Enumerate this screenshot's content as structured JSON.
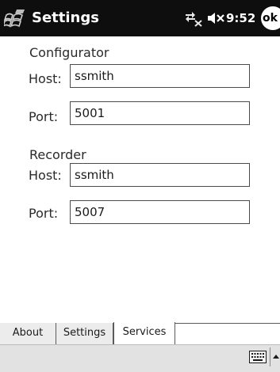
{
  "titlebar": {
    "title": "Settings",
    "time": "9:52",
    "ok_label": "ok"
  },
  "icons": {
    "start": "windows-start-flag-icon",
    "connectivity": "connectivity-icon",
    "volume": "volume-muted-icon",
    "keyboard": "keyboard-icon",
    "sip_arrow": "up-arrow-icon"
  },
  "form": {
    "configurator": {
      "heading": "Configurator",
      "host_label": "Host:",
      "host_value": "ssmith",
      "port_label": "Port:",
      "port_value": "5001"
    },
    "recorder": {
      "heading": "Recorder",
      "host_label": "Host:",
      "host_value": "ssmith",
      "port_label": "Port:",
      "port_value": "5007"
    }
  },
  "tabs": [
    {
      "label": "About"
    },
    {
      "label": "Settings"
    },
    {
      "label": "Services",
      "active": true
    }
  ],
  "colors": {
    "titlebar_bg": "#0e0e0e",
    "content_bg": "#ffffff",
    "commandbar_bg": "#e2e2e2"
  }
}
